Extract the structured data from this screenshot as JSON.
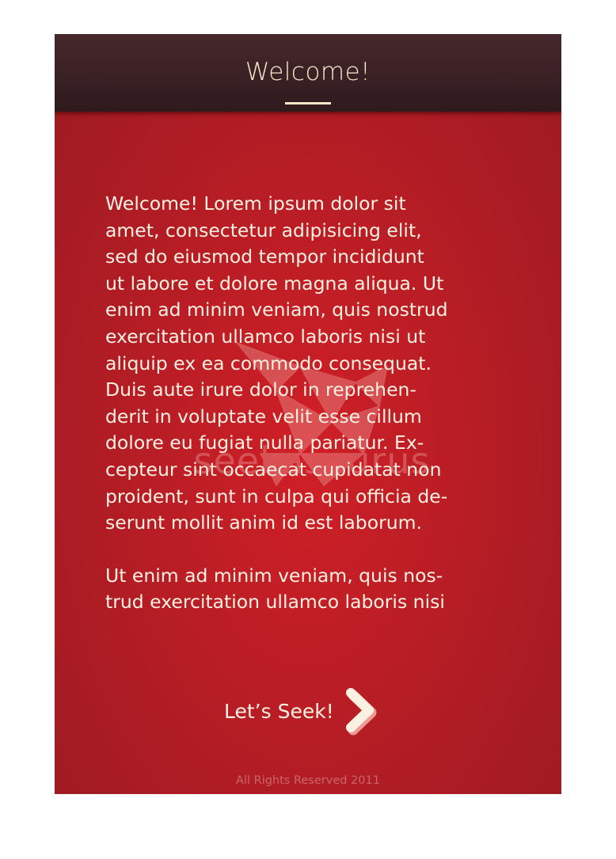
{
  "header": {
    "title": "Welcome!"
  },
  "content": {
    "paragraphs": [
      "Welcome! Lorem ipsum dolor sit\namet, consectetur adipisicing elit,\nsed do eiusmod tempor incididunt\nut labore et dolore magna aliqua. Ut\nenim ad minim veniam, quis nostrud\nexercitation ullamco laboris nisi ut\naliquip ex ea commodo consequat.\nDuis aute irure dolor in reprehen-\nderit in voluptate velit esse cillum\ndolore eu fugiat nulla pariatur. Ex-\ncepteur sint occaecat cupidatat non\nproident, sunt in culpa qui officia de-\nserunt mollit anim id est laborum.",
      "Ut enim ad minim veniam, quis nos-\ntrud exercitation ullamco laboris nisi"
    ]
  },
  "watermark": {
    "text": "seekasaurus"
  },
  "cta": {
    "label": "Let’s Seek!",
    "icon": "chevron-right-icon"
  },
  "footer": {
    "text": "All Rights Reserved 2011"
  },
  "colors": {
    "background": "#b81d25",
    "header": "#3a2125",
    "text": "#fbf1e3",
    "accent": "#f7e6c8"
  }
}
